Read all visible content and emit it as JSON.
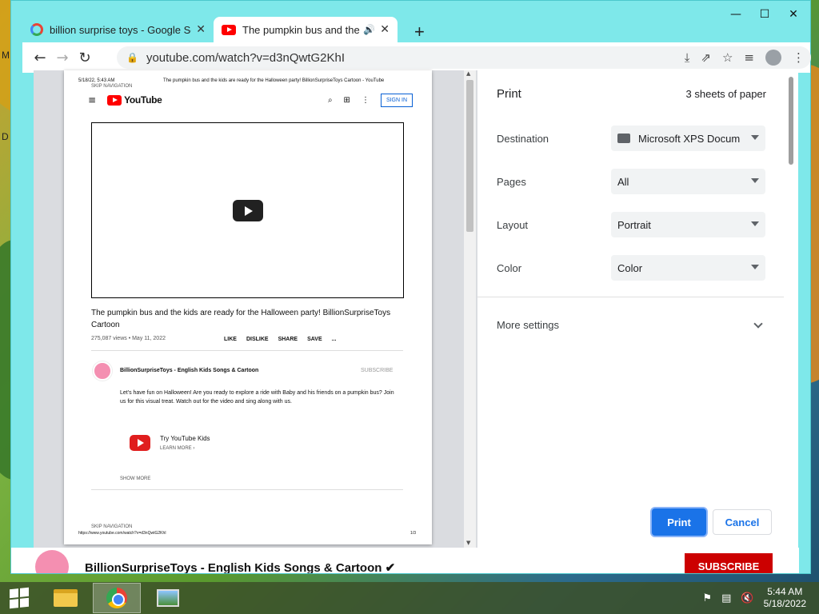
{
  "desktop": {
    "left_letters": [
      "M",
      "D"
    ]
  },
  "window": {
    "controls": {
      "minimize": "—",
      "maximize": "☐",
      "close": "✕"
    }
  },
  "tabs": [
    {
      "title": "billion surprise toys - Google Se",
      "close": "✕",
      "icon": "google-icon"
    },
    {
      "title": "The pumpkin bus and the kid",
      "audio": "🔊",
      "close": "✕",
      "icon": "youtube-icon"
    }
  ],
  "new_tab": "+",
  "toolbar": {
    "back": "←",
    "forward": "→",
    "reload": "↻",
    "lock": "🔒",
    "url": "youtube.com/watch?v=d3nQwtG2KhI",
    "icons": {
      "install": "⤓",
      "share": "⇗",
      "bookmark": "☆",
      "media": "≡",
      "menu": "⋮"
    }
  },
  "preview": {
    "header_date": "5/18/22, 5:43 AM",
    "header_title": "The pumpkin bus and the kids are ready for the Halloween party! BillionSurpriseToys Cartoon - YouTube",
    "skip_nav": "SKIP NAVIGATION",
    "hamburger": "≡",
    "logo_text": "YouTube",
    "search_icon": "⌕",
    "apps_icon": "⊞",
    "more_icon": "⋮",
    "signin": "SIGN IN",
    "video_title": "The pumpkin bus and the kids are ready for the Halloween party! BillionSurpriseToys Cartoon",
    "views": "275,087 views • May 11, 2022",
    "actions": [
      "LIKE",
      "DISLIKE",
      "SHARE",
      "SAVE",
      "..."
    ],
    "channel_name": "BillionSurpriseToys - English Kids Songs & Cartoon",
    "subscribe": "SUBSCRIBE",
    "description": "Let's have fun on Halloween! Are you ready to explore a ride with Baby and his friends on a pumpkin bus? Join us for this visual treat. Watch out for the video and sing along with us.",
    "ytkids_title": "Try YouTube Kids",
    "ytkids_learn": "LEARN MORE ›",
    "show_more": "SHOW MORE",
    "skip_nav2": "SKIP NAVIGATION",
    "footer_url": "https://www.youtube.com/watch?v=d3nQwtG2KhI",
    "footer_page": "1/3"
  },
  "print": {
    "title": "Print",
    "sheets": "3 sheets of paper",
    "destination_label": "Destination",
    "destination_value": "Microsoft XPS Docum",
    "pages_label": "Pages",
    "pages_value": "All",
    "layout_label": "Layout",
    "layout_value": "Portrait",
    "color_label": "Color",
    "color_value": "Color",
    "more_settings": "More settings",
    "print_button": "Print",
    "cancel_button": "Cancel",
    "accent": "#1a73e8"
  },
  "behind": {
    "channel_name": "BillionSurpriseToys - English Kids Songs & Cartoon ✔",
    "subscribe": "SUBSCRIBE"
  },
  "taskbar": {
    "time": "5:44 AM",
    "date": "5/18/2022",
    "tray": [
      "⚑",
      "▤",
      "🔇"
    ]
  }
}
